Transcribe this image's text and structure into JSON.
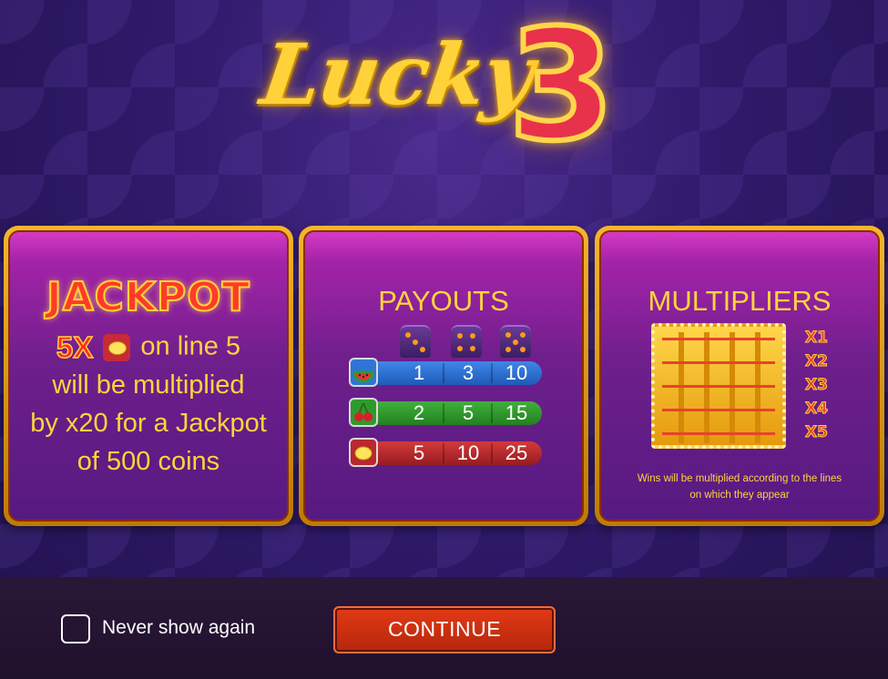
{
  "logo": {
    "word": "Lucky",
    "number": "3"
  },
  "jackpot": {
    "title": "JACKPOT",
    "multiplier": "5X",
    "symbol_icon": "lemon-icon",
    "line_text": "on line 5",
    "lines": [
      "will be multiplied",
      "by x20 for a Jackpot",
      "of 500 coins"
    ]
  },
  "payouts": {
    "title": "PAYOUTS",
    "dice_faces": [
      3,
      4,
      5
    ],
    "rows": [
      {
        "symbol": "watermelon-icon",
        "color": "#2f74d8",
        "values": [
          "1",
          "3",
          "10"
        ]
      },
      {
        "symbol": "cherries-icon",
        "color": "#2e9a2e",
        "values": [
          "2",
          "5",
          "15"
        ]
      },
      {
        "symbol": "lemon-icon",
        "color": "#b8282e",
        "values": [
          "5",
          "10",
          "25"
        ]
      }
    ]
  },
  "multipliers": {
    "title": "MULTIPLIERS",
    "labels": [
      "X1",
      "X2",
      "X3",
      "X4",
      "X5"
    ],
    "note_line1": "Wins will be multiplied according to the lines",
    "note_line2": "on which they appear"
  },
  "footer": {
    "checkbox_label": "Never show again",
    "checkbox_checked": false,
    "continue_label": "CONTINUE"
  }
}
